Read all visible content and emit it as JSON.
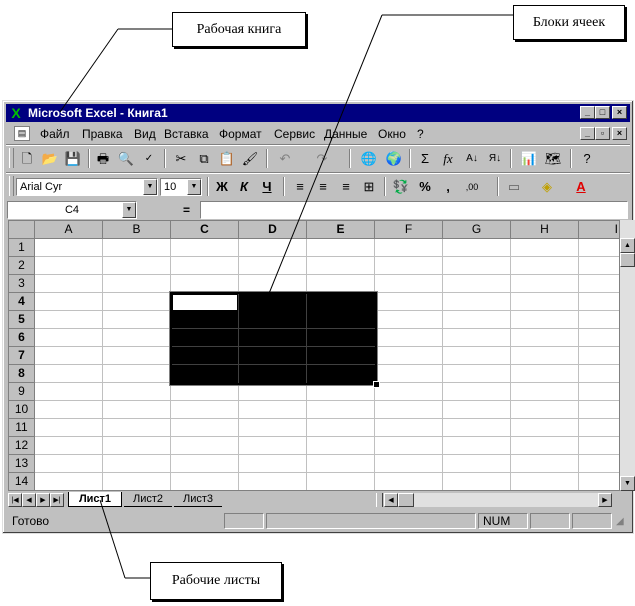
{
  "annotations": {
    "workbook": "Рабочая книга",
    "cell_blocks": "Блоки ячеек",
    "worksheets": "Рабочие листы"
  },
  "window": {
    "title": "Microsoft Excel - Книга1",
    "app_icon": "excel-icon"
  },
  "menu": [
    "Файл",
    "Правка",
    "Вид",
    "Вставка",
    "Формат",
    "Сервис",
    "Данные",
    "Окно",
    "?"
  ],
  "format_toolbar": {
    "font": "Arial Cyr",
    "size": "10",
    "bold": "Ж",
    "italic": "К",
    "underline": "Ч"
  },
  "formula_bar": {
    "name_box": "C4",
    "equals": "="
  },
  "columns": [
    "A",
    "B",
    "C",
    "D",
    "E",
    "F",
    "G",
    "H",
    "I"
  ],
  "rows": [
    "1",
    "2",
    "3",
    "4",
    "5",
    "6",
    "7",
    "8",
    "9",
    "10",
    "11",
    "12",
    "13",
    "14"
  ],
  "selection": {
    "active_cell": "C4",
    "range": "C4:E8",
    "fill_color": "#000000"
  },
  "sheet_tabs": [
    "Лист1",
    "Лист2",
    "Лист3"
  ],
  "active_tab": "Лист1",
  "status": {
    "ready": "Готово",
    "num": "NUM"
  },
  "colors": {
    "titlebar": "#000080",
    "chrome": "#c0c0c0",
    "grid": "#c0c0c0"
  }
}
